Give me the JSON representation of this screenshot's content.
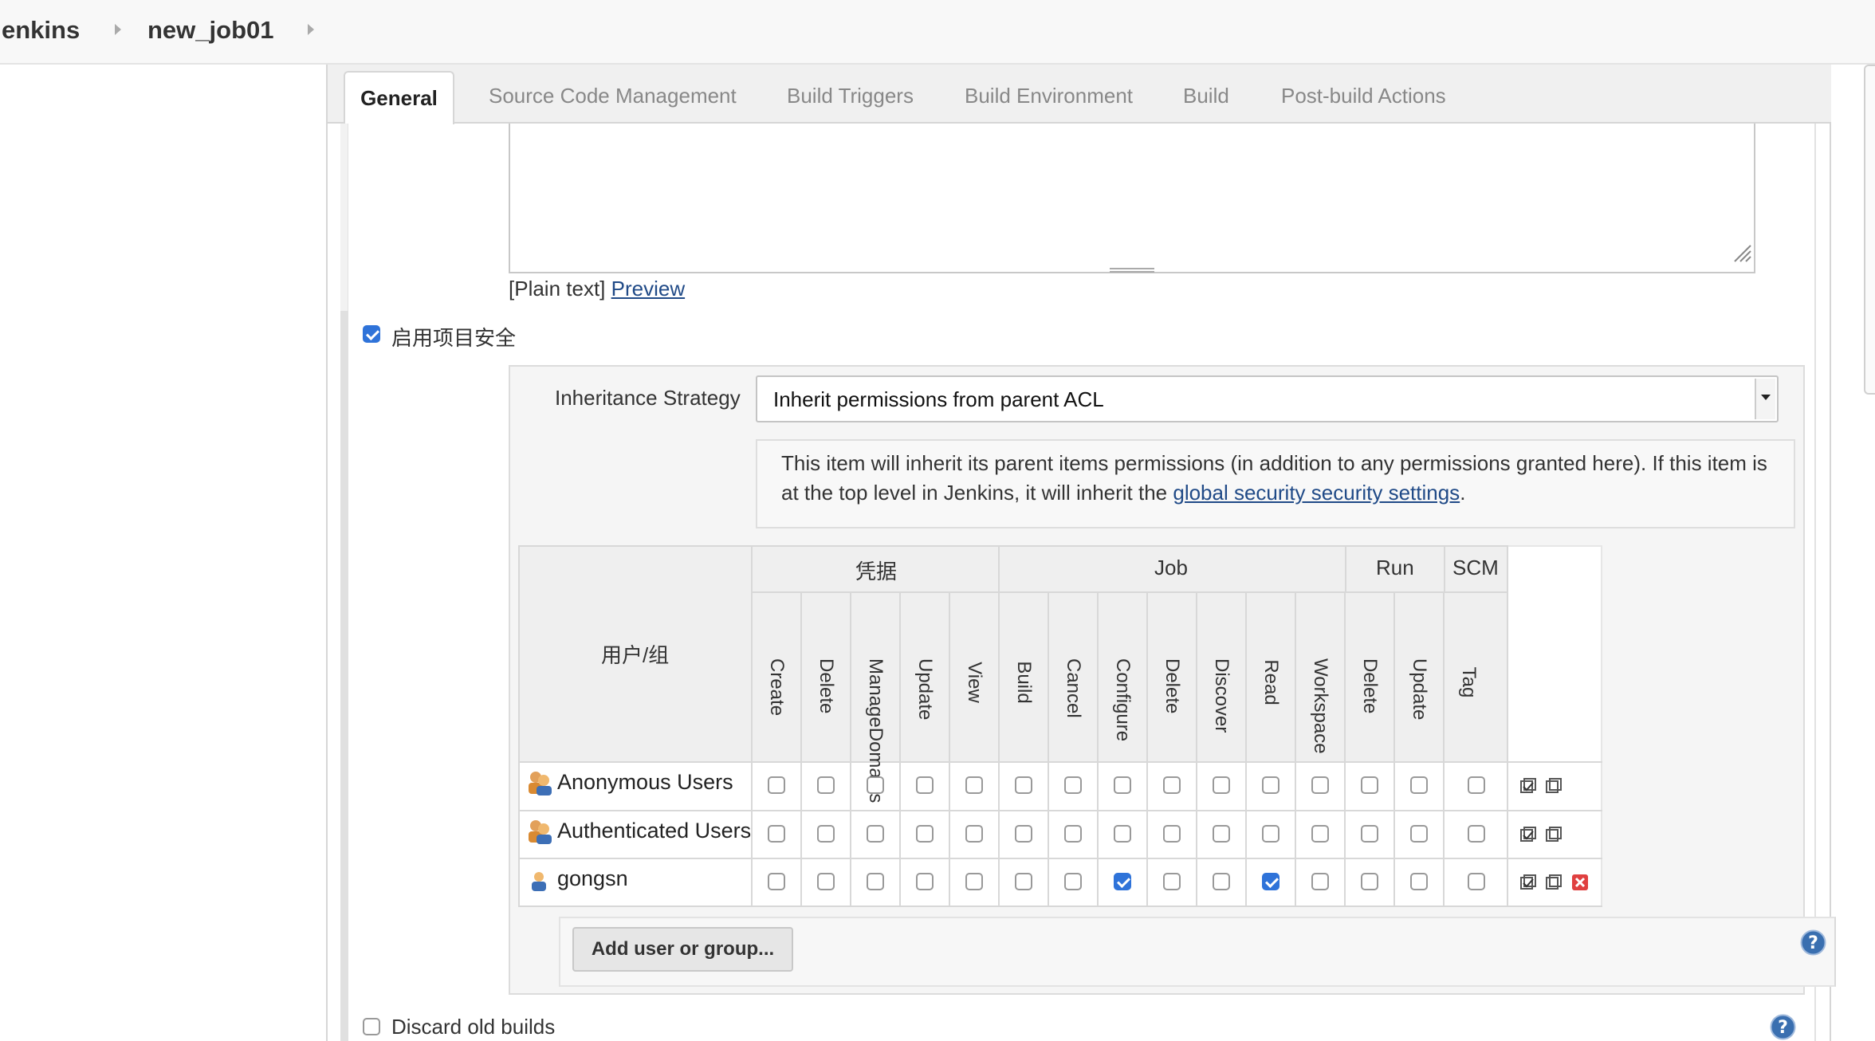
{
  "breadcrumbs": [
    "enkins",
    "new_job01"
  ],
  "tabs": {
    "general": "General",
    "scm": "Source Code Management",
    "triggers": "Build Triggers",
    "environment": "Build Environment",
    "build": "Build",
    "post_build": "Post-build Actions"
  },
  "description": {
    "value": "",
    "format_label": "[Plain text] ",
    "preview_link": "Preview"
  },
  "project_security": {
    "label": "启用项目安全",
    "checked": true
  },
  "inheritance": {
    "label": "Inheritance Strategy",
    "selected": "Inherit permissions from parent ACL",
    "info_text": "This item will inherit its parent items permissions (in addition to any permissions granted here). If this item is at the top level in Jenkins, it will inherit the ",
    "info_link": "global security security settings",
    "info_suffix": "."
  },
  "matrix": {
    "user_group_header": "用户/组",
    "groups": [
      "凭据",
      "Job",
      "Run",
      "SCM"
    ],
    "columns": [
      "Create",
      "Delete",
      "ManageDomains",
      "Update",
      "View",
      "Build",
      "Cancel",
      "Configure",
      "Delete",
      "Discover",
      "Read",
      "Workspace",
      "Delete",
      "Update",
      "Tag"
    ],
    "rows": [
      {
        "name": "Anonymous Users",
        "type": "group",
        "checked": [
          false,
          false,
          false,
          false,
          false,
          false,
          false,
          false,
          false,
          false,
          false,
          false,
          false,
          false,
          false
        ],
        "removable": false
      },
      {
        "name": "Authenticated Users",
        "type": "group",
        "checked": [
          false,
          false,
          false,
          false,
          false,
          false,
          false,
          false,
          false,
          false,
          false,
          false,
          false,
          false,
          false
        ],
        "removable": false
      },
      {
        "name": "gongsn",
        "type": "user",
        "checked": [
          false,
          false,
          false,
          false,
          false,
          false,
          false,
          true,
          false,
          false,
          true,
          false,
          false,
          false,
          false
        ],
        "removable": true
      }
    ],
    "add_button": "Add user or group..."
  },
  "discard_old_builds": {
    "label": "Discard old builds",
    "checked": false
  },
  "icons": {
    "group": "users-group-icon",
    "user": "user-icon",
    "select_all": "check-all-icon",
    "unselect_all": "uncheck-all-icon",
    "remove": "remove-icon",
    "help": "help-icon"
  },
  "colors": {
    "accent": "#2f73d9",
    "link": "#204a87",
    "remove": "#e04040",
    "help": "#3a6fb0"
  }
}
